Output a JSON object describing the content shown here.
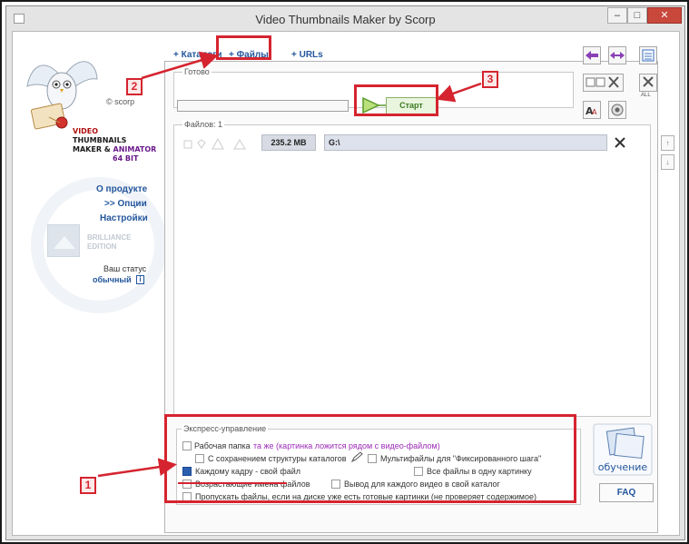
{
  "window": {
    "title": "Video Thumbnails Maker by Scorp",
    "minimize": "–",
    "maximize": "□",
    "close": "✕"
  },
  "sidebar": {
    "copyright": "© scorp",
    "brand_line1": "VIDEO",
    "brand_line2": "THUMBNAILS",
    "brand_line3a": "MAKER & ",
    "brand_line3b": "ANIMATOR",
    "brand_line4": "64 BIT",
    "links": [
      "О продукте",
      ">> Опции",
      "Настройки"
    ],
    "brilliance_line1": "BRILLIANCE",
    "brilliance_line2": "EDITION",
    "status_label": "Ваш статус",
    "status_value": "обычный",
    "info": "i"
  },
  "tabs": [
    "+ Каталоги",
    "+ Файлы",
    "+ URLs"
  ],
  "ready": {
    "label": "Готово",
    "start_label": "Старт"
  },
  "files": {
    "label": "Файлов: 1",
    "rows": [
      {
        "size": "235.2 MB",
        "path": "G:\\"
      }
    ]
  },
  "right_side": {
    "all_label": "ALL"
  },
  "express": {
    "title": "Экспресс-управление",
    "options": {
      "work_folder": "Рабочая папка",
      "work_folder_value": "та же (картинка ложится рядом с видео-файлом)",
      "keep_structure": "С сохранением структуры каталогов",
      "multifiles": "Мультифайлы для \"Фиксированного шага\"",
      "each_frame": "Каждому кадру - свой файл",
      "all_in_one": "Все файлы в одну картинку",
      "ascending": "Возрастающие имена файлов",
      "output_each": "Вывод для каждого видео в свой каталог",
      "skip": "Пропускать файлы, если на диске уже есть готовые картинки (не проверяет содержимое)"
    },
    "bullet": "•"
  },
  "help": {
    "obuchenie": "обучение",
    "faq": "FAQ"
  },
  "annotations": {
    "badge1": "1",
    "badge2": "2",
    "badge3": "3"
  },
  "colors": {
    "annotation_red": "#d5242f",
    "link_blue": "#23569c",
    "start_green": "#3d7a22",
    "accent_purple": "#9c2ab7"
  }
}
